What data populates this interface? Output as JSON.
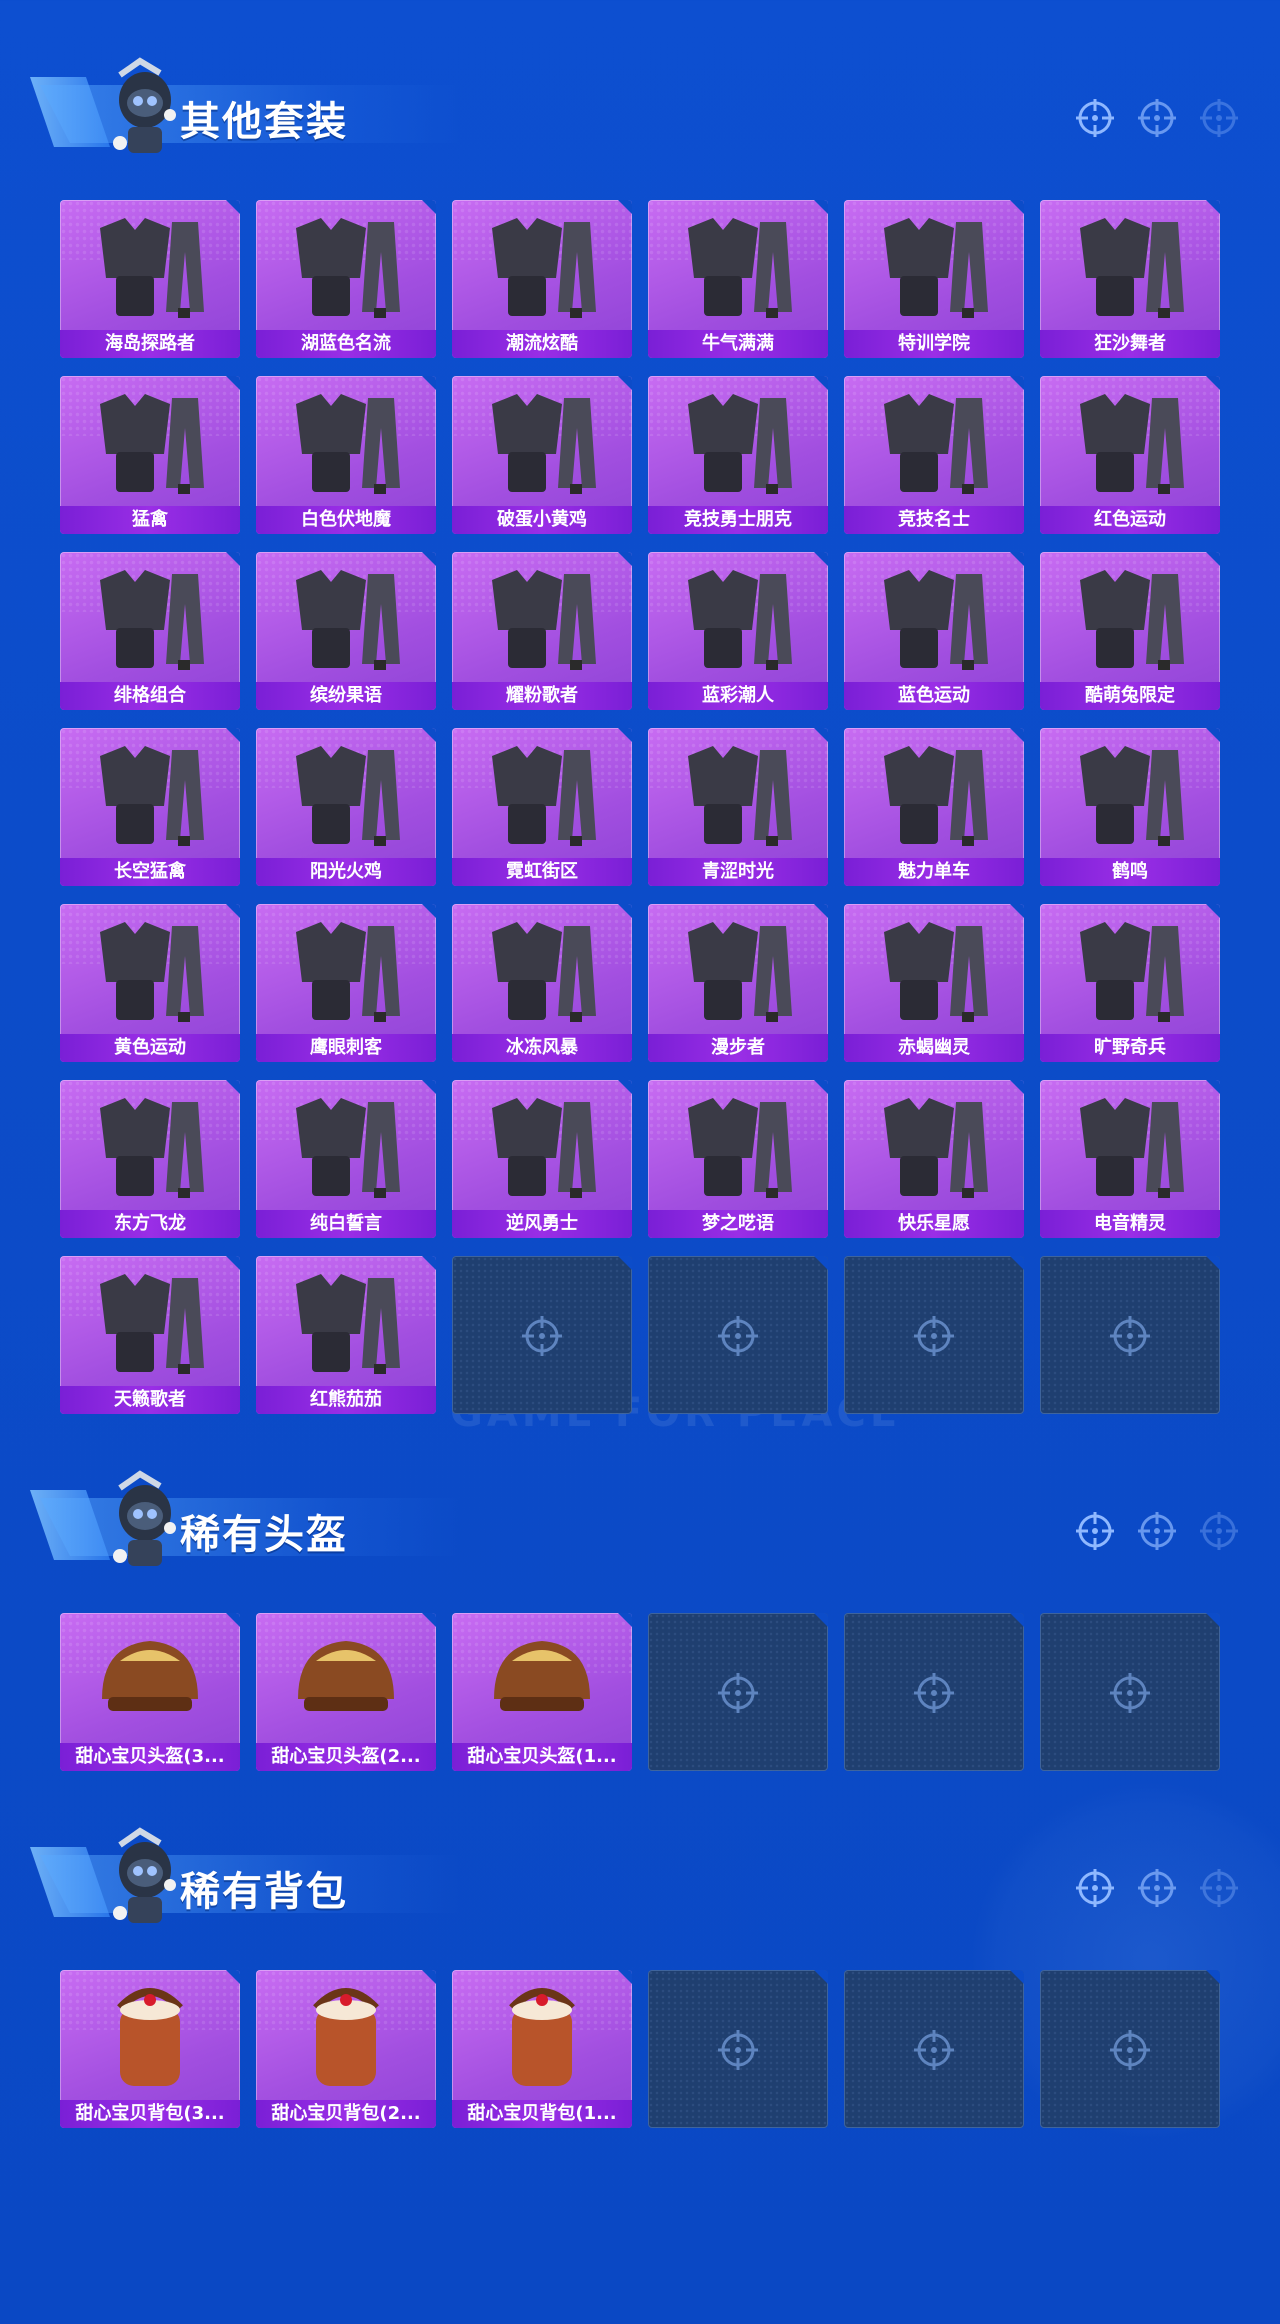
{
  "sections": [
    {
      "title": "其他套装",
      "items": [
        "海岛探路者",
        "湖蓝色名流",
        "潮流炫酷",
        "牛气满满",
        "特训学院",
        "狂沙舞者",
        "猛禽",
        "白色伏地魔",
        "破蛋小黄鸡",
        "竞技勇士朋克",
        "竞技名士",
        "红色运动",
        "绯格组合",
        "缤纷果语",
        "耀粉歌者",
        "蓝彩潮人",
        "蓝色运动",
        "酷萌兔限定",
        "长空猛禽",
        "阳光火鸡",
        "霓虹街区",
        "青涩时光",
        "魅力单车",
        "鹤鸣",
        "黄色运动",
        "鹰眼刺客",
        "冰冻风暴",
        "漫步者",
        "赤蝎幽灵",
        "旷野奇兵",
        "东方飞龙",
        "纯白誓言",
        "逆风勇士",
        "梦之呓语",
        "快乐星愿",
        "电音精灵",
        "天籁歌者",
        "红熊茄茄"
      ]
    },
    {
      "title": "稀有头盔",
      "items": [
        "甜心宝贝头盔(3...",
        "甜心宝贝头盔(2...",
        "甜心宝贝头盔(1..."
      ]
    },
    {
      "title": "稀有背包",
      "items": [
        "甜心宝贝背包(3...",
        "甜心宝贝背包(2...",
        "甜心宝贝背包(1..."
      ]
    }
  ],
  "watermark": "GAME FOR PEACE",
  "colors": {
    "card": "#a24fe0",
    "label": "#7a1fd6",
    "empty": "#1f3f70",
    "background": "#0c4cc9"
  }
}
